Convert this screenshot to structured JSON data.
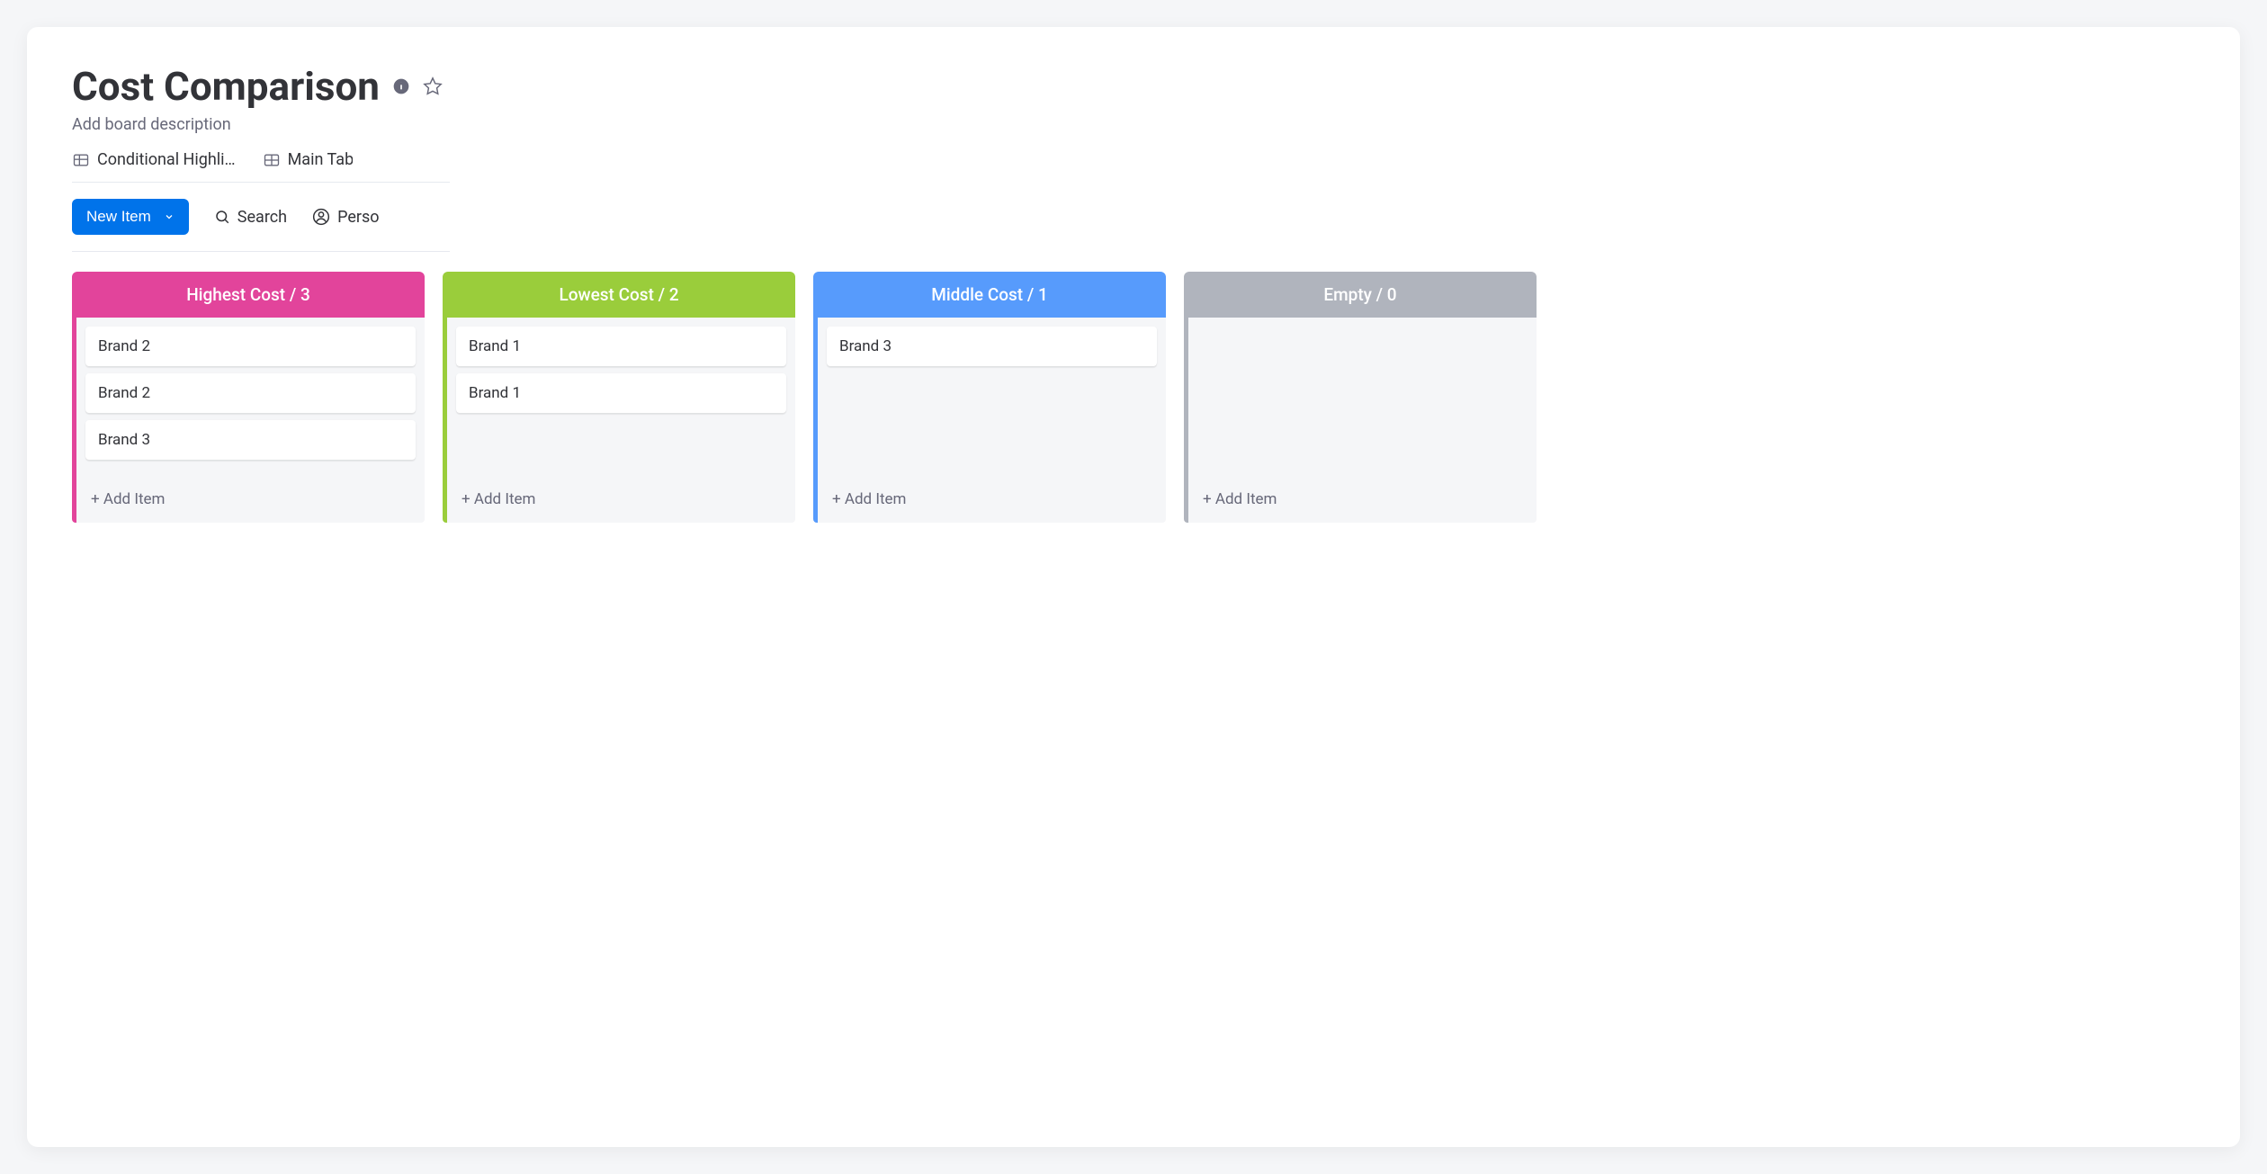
{
  "board": {
    "title": "Cost Comparison",
    "description": "Add board description"
  },
  "tabs": [
    {
      "label": "Conditional Highli…"
    },
    {
      "label": "Main Tab"
    }
  ],
  "toolbar": {
    "new_item": "New Item",
    "search": "Search",
    "person": "Perso"
  },
  "columns": [
    {
      "title": "Highest Cost / 3",
      "color": "pink",
      "items": [
        "Brand 2",
        "Brand 2",
        "Brand 3"
      ],
      "add_label": "+ Add Item"
    },
    {
      "title": "Lowest Cost / 2",
      "color": "green",
      "items": [
        "Brand 1",
        "Brand 1"
      ],
      "add_label": "+ Add Item"
    },
    {
      "title": "Middle Cost / 1",
      "color": "blue",
      "items": [
        "Brand 3"
      ],
      "add_label": "+ Add Item"
    },
    {
      "title": "Empty / 0",
      "color": "grey",
      "items": [],
      "add_label": "+ Add Item"
    }
  ]
}
